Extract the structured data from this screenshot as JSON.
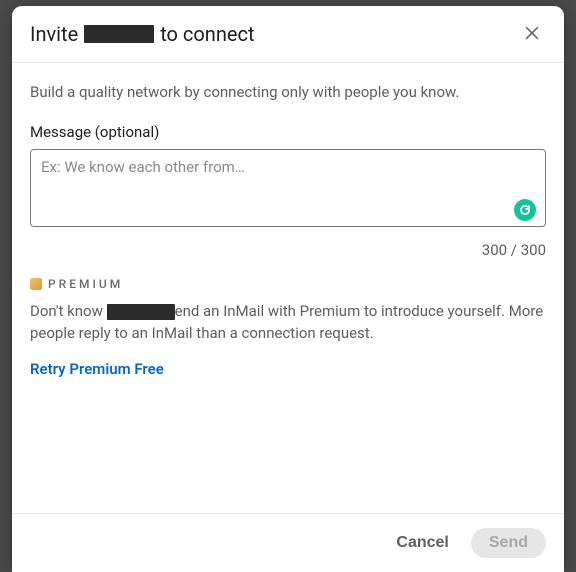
{
  "header": {
    "title_prefix": "Invite",
    "title_suffix": "to connect"
  },
  "body": {
    "helper": "Build a quality network by connecting only with people you know.",
    "message_label": "Message (optional)",
    "message_placeholder": "Ex: We know each other from…",
    "char_count": "300 / 300",
    "premium_label": "PREMIUM",
    "inmail_prefix": "Don't know ",
    "inmail_suffix": "end an InMail with Premium to introduce yourself. More people reply to an InMail than a connection request.",
    "retry_link": "Retry Premium Free"
  },
  "footer": {
    "cancel": "Cancel",
    "send": "Send"
  }
}
